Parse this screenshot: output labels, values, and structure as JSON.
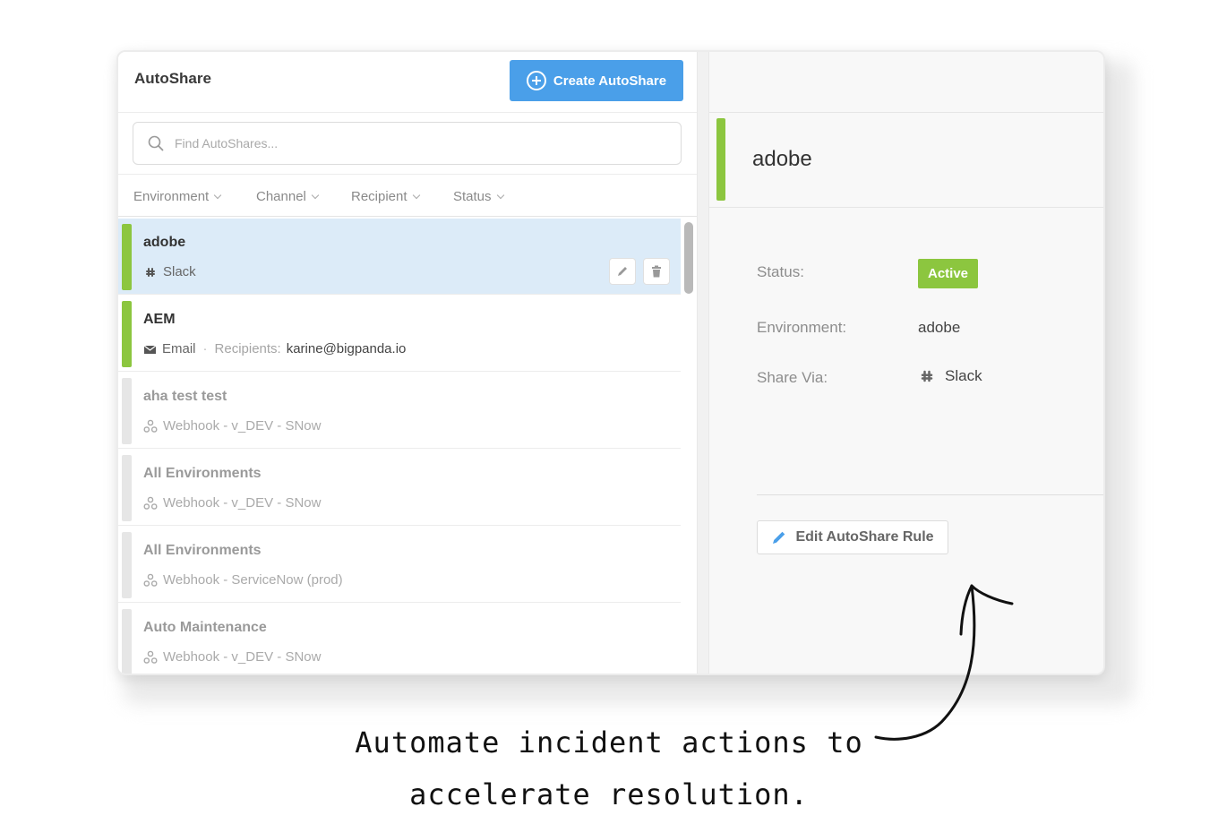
{
  "header": {
    "title": "AutoShare",
    "create_label": "Create AutoShare"
  },
  "search": {
    "placeholder": "Find AutoShares..."
  },
  "filters": [
    "Environment",
    "Channel",
    "Recipient",
    "Status"
  ],
  "list": [
    {
      "name": "adobe",
      "channel_icon": "slack-icon",
      "channel": "Slack",
      "state": "active",
      "selected": true
    },
    {
      "name": "AEM",
      "channel_icon": "email-icon",
      "channel": "Email",
      "recipients_label": "Recipients:",
      "recipients": "karine@bigpanda.io",
      "state": "active"
    },
    {
      "name": "aha test test",
      "channel_icon": "webhook-icon",
      "channel": "Webhook - v_DEV - SNow",
      "state": "inactive"
    },
    {
      "name": "All Environments",
      "channel_icon": "webhook-icon",
      "channel": "Webhook - v_DEV - SNow",
      "state": "inactive"
    },
    {
      "name": "All Environments",
      "channel_icon": "webhook-icon",
      "channel": "Webhook - ServiceNow (prod)",
      "state": "inactive"
    },
    {
      "name": "Auto Maintenance",
      "channel_icon": "webhook-icon",
      "channel": "Webhook - v_DEV - SNow",
      "state": "inactive"
    }
  ],
  "detail": {
    "title": "adobe",
    "status_label": "Status:",
    "status_value": "Active",
    "environment_label": "Environment:",
    "environment_value": "adobe",
    "share_label": "Share Via:",
    "share_value": "Slack",
    "edit_label": "Edit AutoShare Rule"
  },
  "caption": {
    "line1": "Automate incident actions to",
    "line2": "accelerate resolution."
  },
  "colors": {
    "accent": "#4a9fe9",
    "active_green": "#8cc63f",
    "selected_row": "#dcebf8",
    "inactive_bar": "#e6e6e6"
  }
}
